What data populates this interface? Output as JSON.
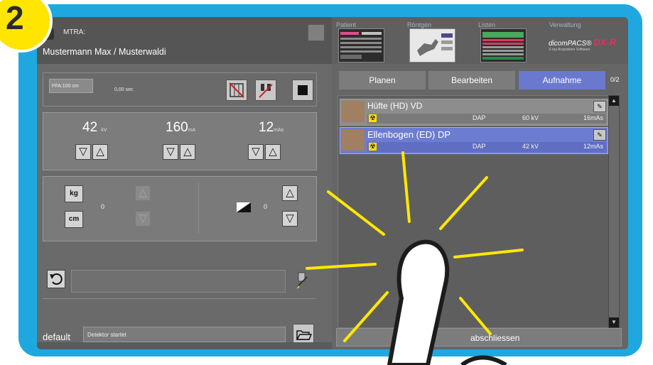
{
  "step_badge": "2",
  "header": {
    "mtra_label": "MTRA:",
    "patient_name": "Mustermann Max / Musterwaldi",
    "tabs": [
      {
        "label": "Patient"
      },
      {
        "label": "Röntgen"
      },
      {
        "label": "Listen"
      },
      {
        "label": "Verwaltung"
      }
    ],
    "logo_small": "dicomPACS®",
    "logo_brand": "DX-R",
    "logo_sub": "X-ray Acquisition Software"
  },
  "exposure": {
    "ffa_label": "FFA:100 cm",
    "time_label": "0,00 sec",
    "kv_value": "42",
    "kv_unit": "kV",
    "ma_value": "160",
    "ma_unit": "mA",
    "mas_value": "12",
    "mas_unit": "mAs",
    "weight_label": "kg",
    "size_label": "cm",
    "weight_value": "0",
    "density_value": "0"
  },
  "status": {
    "profile_label": "default",
    "detector_status": "Detektor startet"
  },
  "workflow": {
    "tabs": [
      {
        "label": "Planen"
      },
      {
        "label": "Bearbeiten"
      },
      {
        "label": "Aufnahme"
      }
    ],
    "counter": "0/2",
    "finish_label": "abschliessen"
  },
  "exams": [
    {
      "name": "Hüfte (HD) VD",
      "dap": "DAP",
      "kv": "60 kV",
      "mas": "16mAs"
    },
    {
      "name": "Ellenbogen (ED) DP",
      "dap": "DAP",
      "kv": "42 kV",
      "mas": "12mAs"
    }
  ],
  "colors": {
    "frame_blue": "#1fa8df",
    "badge_yellow": "#ffe500",
    "selection_blue": "#6c7cd0",
    "tap_rays": "#ffe800"
  },
  "icons": [
    "person-icon",
    "grid-icon",
    "detector-icon",
    "stop-icon",
    "undo-icon",
    "edit-icon",
    "folder-open-icon",
    "radiation-icon",
    "density-icon",
    "hand-pointer-icon",
    "tap-rays-icon"
  ]
}
